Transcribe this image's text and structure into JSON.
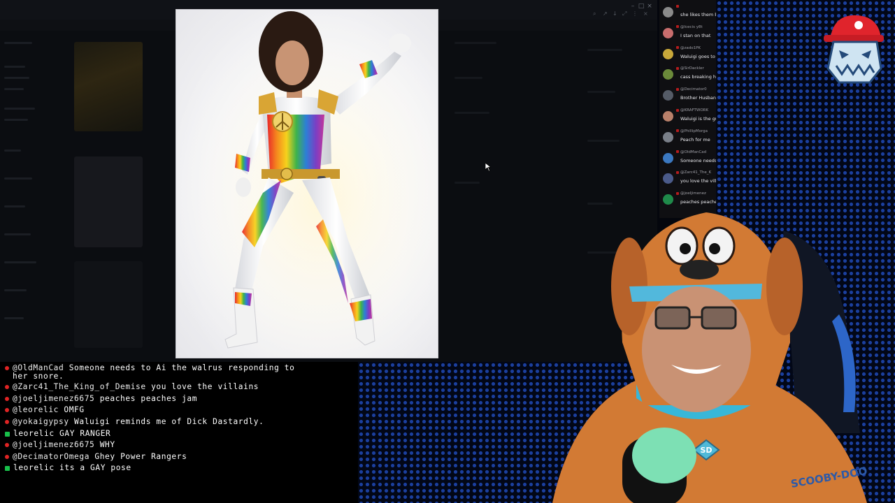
{
  "side_chat": {
    "messages": [
      {
        "handle": "",
        "text": "she likes them b",
        "avatar_color": "#8a8a8a"
      },
      {
        "handle": "@Icecis y8t",
        "text": "I stan on that",
        "avatar_color": "#c86d6d"
      },
      {
        "handle": "@zado1PK",
        "text": "Waluigi goes to",
        "avatar_color": "#c9a83a"
      },
      {
        "handle": "@SirDackler",
        "text": "cass breaking h",
        "avatar_color": "#6b8a3a"
      },
      {
        "handle": "@Decimator0",
        "text": "Brother Husband",
        "avatar_color": "#555b66"
      },
      {
        "handle": "@KRAFTWORK",
        "text": "Waluigi is the gu",
        "avatar_color": "#b9806a"
      },
      {
        "handle": "@PhillipMorga",
        "text": "Peach for me",
        "avatar_color": "#7a7f88"
      },
      {
        "handle": "@OldManCad",
        "text": "Someone needs",
        "avatar_color": "#3b78c0"
      },
      {
        "handle": "@Zarc41_The_K",
        "text": "you love the villa",
        "avatar_color": "#4b5b8a"
      },
      {
        "handle": "@joeljimenez",
        "text": "peaches peache",
        "avatar_color": "#1f8a4a"
      }
    ]
  },
  "bottom_chat": {
    "lines": [
      {
        "user": "@OldManCad",
        "text": "Someone needs to Ai the walrus responding to",
        "cont": "her snore.",
        "badge": "red"
      },
      {
        "user": "@Zarc41_The_King_of_Demise",
        "text": "you love the villains",
        "badge": "red"
      },
      {
        "user": "@joeljimenez6675",
        "text": "peaches peaches jam",
        "badge": "red"
      },
      {
        "user": "@leorelic",
        "text": "OMFG",
        "badge": "red"
      },
      {
        "user": "@yokaigypsy",
        "text": "Waluigi reminds me of Dick Dastardly.",
        "badge": "red"
      },
      {
        "user": "leorelic",
        "text": "GAY RANGER",
        "badge": "green"
      },
      {
        "user": "@joeljimenez6675",
        "text": "WHY",
        "badge": "red"
      },
      {
        "user": "@DecimatorOmega",
        "text": "Ghey Power Rangers",
        "badge": "red"
      },
      {
        "user": "leorelic",
        "text": "its a GAY pose",
        "badge": "green"
      }
    ]
  },
  "webcam": {
    "hoodie_print": "SCOOBY-DOO",
    "collar_tag": "SD"
  },
  "colors": {
    "led_blue": "#1b3f9e",
    "badge_red": "#e02424",
    "badge_green": "#18c04a",
    "hoodie_orange": "#d27a34",
    "cap_blue": "#52b8dc"
  }
}
